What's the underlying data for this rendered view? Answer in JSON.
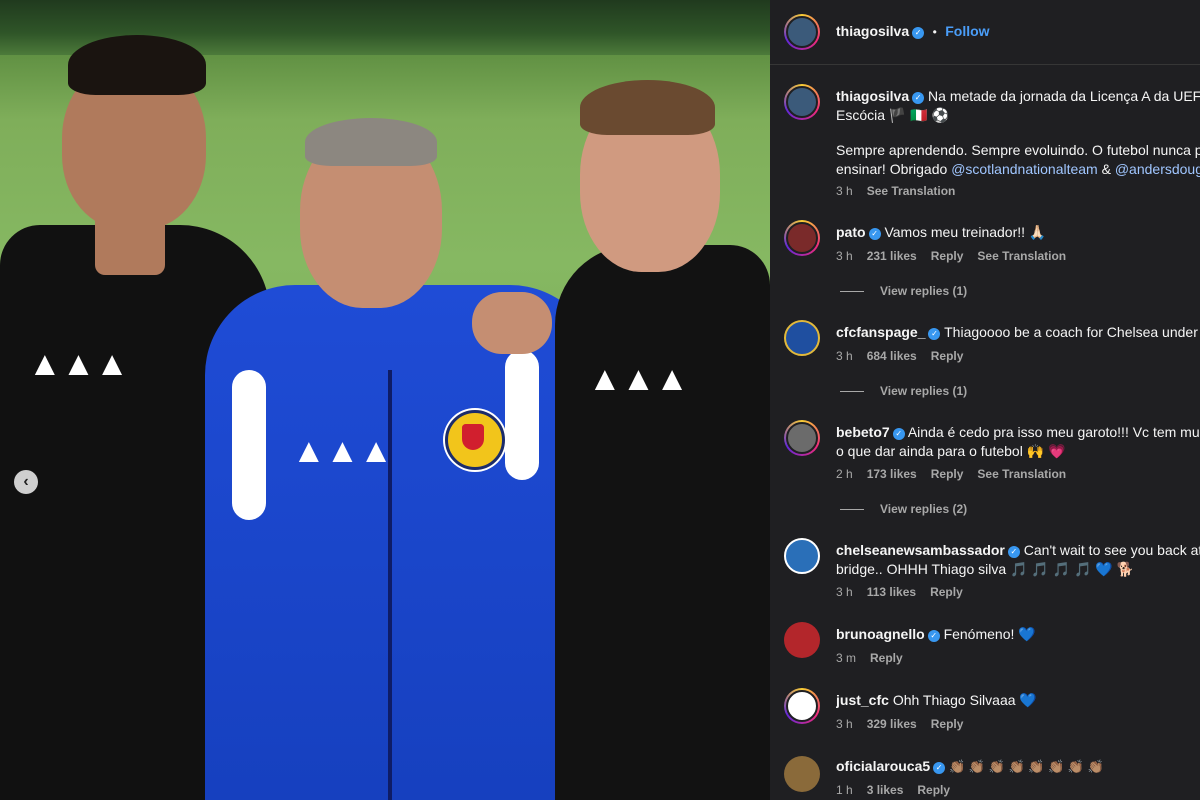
{
  "post": {
    "username": "thiagosilva",
    "follow_label": "Follow",
    "separator": "•",
    "caption_line1": "Na metade da jornada da Licença A da UEFA",
    "caption_line2": "Escócia 🏴 🇮🇹 ⚽",
    "caption_line3": "Sempre aprendendo. Sempre evoluindo. O futebol nunca p",
    "caption_line4_prefix": "ensinar! Obrigado ",
    "mention1": "@scotlandnationalteam",
    "amp": " & ",
    "mention2": "@andersdoug",
    "time": "3 h",
    "see_translation": "See Translation"
  },
  "carousel": {
    "prev_icon": "‹"
  },
  "comments": [
    {
      "user": "pato",
      "text": "Vamos meu treinador!! 🙏🏻",
      "time": "3 h",
      "likes": "231 likes",
      "reply": "Reply",
      "translation": "See Translation",
      "view_replies": "View replies (1)",
      "color": "#7a2a2a"
    },
    {
      "user": "cfcfanspage_",
      "text": "Thiagoooo be a coach for Chelsea under X",
      "time": "3 h",
      "likes": "684 likes",
      "reply": "Reply",
      "translation": "",
      "view_replies": "View replies (1)",
      "color": "#1f4fa0"
    },
    {
      "user": "bebeto7",
      "text": "Ainda é cedo pra isso meu garoto!!! Vc tem mu",
      "text2": "o que dar ainda para o futebol 🙌 💗",
      "time": "2 h",
      "likes": "173 likes",
      "reply": "Reply",
      "translation": "See Translation",
      "view_replies": "View replies (2)",
      "color": "#6b6b6b"
    },
    {
      "user": "chelseanewsambassador",
      "text": "Can't wait to see you back at th",
      "text2": "bridge.. OHHH Thiago silva 🎵 🎵 🎵 🎵 💙 🐕",
      "time": "3 h",
      "likes": "113 likes",
      "reply": "Reply",
      "color": "#2a6fb8"
    },
    {
      "user": "brunoagnello",
      "text": "Fenómeno! 💙",
      "time": "3 m",
      "reply": "Reply",
      "color": "#b3262b"
    },
    {
      "user": "just_cfc",
      "text": "Ohh Thiago Silvaaa 💙",
      "time": "3 h",
      "likes": "329 likes",
      "reply": "Reply",
      "color": "#1d3f96"
    },
    {
      "user": "oficialarouca5",
      "text": "👏🏽 👏🏽 👏🏽 👏🏽 👏🏽 👏🏽 👏🏽 👏🏽",
      "time": "1 h",
      "likes": "3 likes",
      "reply": "Reply",
      "color": "#8a6a3a"
    }
  ],
  "colors": {
    "panel_bg": "#1f1f22",
    "link": "#4a9df8",
    "mention": "#a0c6ff",
    "muted": "#a8a8a8"
  }
}
